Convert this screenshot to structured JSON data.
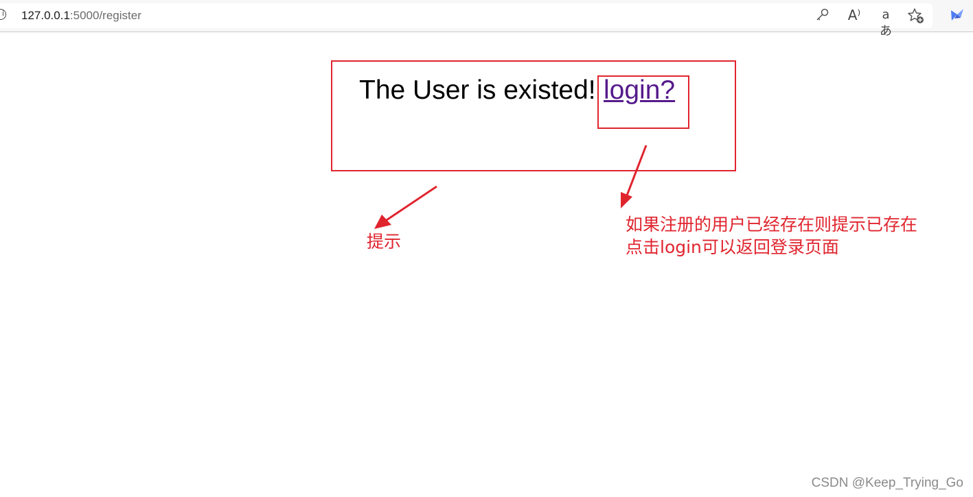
{
  "browser": {
    "url_host": "127.0.0.1",
    "url_path": ":5000/register",
    "icons": [
      "info-icon",
      "key-icon",
      "read-aloud-icon",
      "translate-icon",
      "add-favorite-icon",
      "extension-icon"
    ],
    "read_aloud_glyph": "A⁾",
    "translate_glyph": "aあ"
  },
  "page": {
    "message": "The User is existed!",
    "login_link": "login?"
  },
  "annotations": {
    "hint": "提示",
    "description_line1": "如果注册的用户已经存在则提示已存在",
    "description_line2": "点击login可以返回登录页面",
    "color": "#e0242e"
  },
  "watermark": "CSDN @Keep_Trying_Go"
}
